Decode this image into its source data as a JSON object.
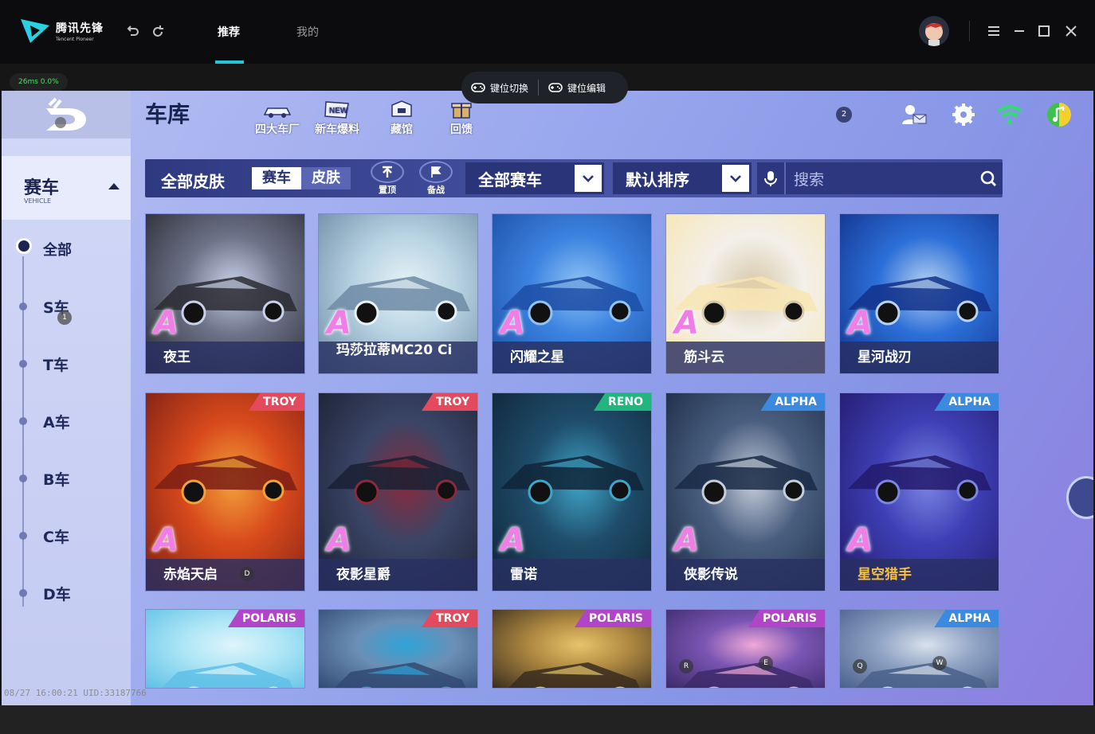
{
  "app": {
    "name_cn": "腾讯先锋",
    "name_en": "Tencent Pioneer"
  },
  "tabs": [
    {
      "label": "推荐",
      "active": true
    },
    {
      "label": "我的",
      "active": false
    }
  ],
  "status": {
    "ping": "26ms 0.0%"
  },
  "keybar": {
    "switch_label": "键位切换",
    "edit_label": "键位编辑"
  },
  "game": {
    "title": "车库",
    "top_menu": [
      {
        "label": "四大车厂",
        "icon": "car-factory-icon"
      },
      {
        "label": "新车爆料",
        "icon": "new-badge-icon"
      },
      {
        "label": "藏馆",
        "icon": "museum-icon"
      },
      {
        "label": "回馈",
        "icon": "gift-icon"
      }
    ],
    "notify_count": "2",
    "sidebar": {
      "category": "赛车",
      "category_en": "VEHICLE",
      "items": [
        "全部",
        "S车",
        "T车",
        "A车",
        "B车",
        "C车",
        "D车"
      ]
    },
    "filter": {
      "all_skins": "全部皮肤",
      "seg_car": "赛车",
      "seg_skin": "皮肤",
      "pin_label": "置顶",
      "prep_label": "备战",
      "car_filter": "全部赛车",
      "sort": "默认排序",
      "search_placeholder": "搜索"
    },
    "cards_row1": [
      {
        "name": "夜王",
        "rank": "A",
        "colors": [
          "#2a2a31",
          "#6c7288",
          "#c9d2e9"
        ]
      },
      {
        "name": "玛莎拉蒂MC20 Ci",
        "rank": "A",
        "colors": [
          "#6d8aa4",
          "#b9d4e3",
          "#e7f2f7"
        ]
      },
      {
        "name": "闪耀之星",
        "rank": "A",
        "colors": [
          "#1c4ea6",
          "#3c83e0",
          "#8fc4f5"
        ]
      },
      {
        "name": "筋斗云",
        "rank": "A",
        "colors": [
          "#f8e5b3",
          "#f3f0ea",
          "#d8c9a8"
        ]
      },
      {
        "name": "星河战刃",
        "rank": "A",
        "colors": [
          "#12318a",
          "#2c6fd8",
          "#b8d3f2"
        ]
      }
    ],
    "cards_row2": [
      {
        "name": "赤焰天启",
        "rank": "A",
        "tag": "TROY",
        "tag_kind": "troy",
        "colors": [
          "#7a1e15",
          "#d94a1c",
          "#f2a23b"
        ],
        "badge": "D"
      },
      {
        "name": "夜影星爵",
        "rank": "A",
        "tag": "TROY",
        "tag_kind": "troy",
        "colors": [
          "#1a2033",
          "#3b4566",
          "#8a2a3c"
        ]
      },
      {
        "name": "雷诺",
        "rank": "A",
        "tag": "RENO",
        "tag_kind": "reno",
        "colors": [
          "#0f2437",
          "#1f4d6b",
          "#40a6c9"
        ]
      },
      {
        "name": "侠影传说",
        "rank": "A",
        "tag": "ALPHA",
        "tag_kind": "alpha",
        "colors": [
          "#1a2a45",
          "#4a5f80",
          "#c7cedb"
        ]
      },
      {
        "name": "星空猎手",
        "rank": "A",
        "tag": "ALPHA",
        "tag_kind": "alpha",
        "colors": [
          "#221a6b",
          "#3e3fb5",
          "#7b86e3"
        ],
        "name_color": "#f7c23a"
      }
    ],
    "cards_row3": [
      {
        "tag": "POLARIS",
        "tag_kind": "polaris",
        "colors": [
          "#5fc0e6",
          "#aee6f6",
          "#dff4fa"
        ]
      },
      {
        "tag": "TROY",
        "tag_kind": "troy",
        "colors": [
          "#314a73",
          "#6b8fb6",
          "#2ea4d8"
        ]
      },
      {
        "tag": "POLARIS",
        "tag_kind": "polaris",
        "colors": [
          "#3a2d1e",
          "#b08a42",
          "#e6c46a"
        ]
      },
      {
        "tag": "POLARIS",
        "tag_kind": "polaris",
        "colors": [
          "#3d2a6a",
          "#7a55b3",
          "#f0a9d8"
        ],
        "badges": [
          "R",
          "E"
        ]
      },
      {
        "tag": "ALPHA",
        "tag_kind": "alpha",
        "colors": [
          "#49608a",
          "#8fa3c4",
          "#d9e1ec"
        ],
        "badges": [
          "Q",
          "W"
        ]
      }
    ],
    "sidebar_badge": "1"
  },
  "timestamp": "08/27 16:00:21 UID:33187766"
}
